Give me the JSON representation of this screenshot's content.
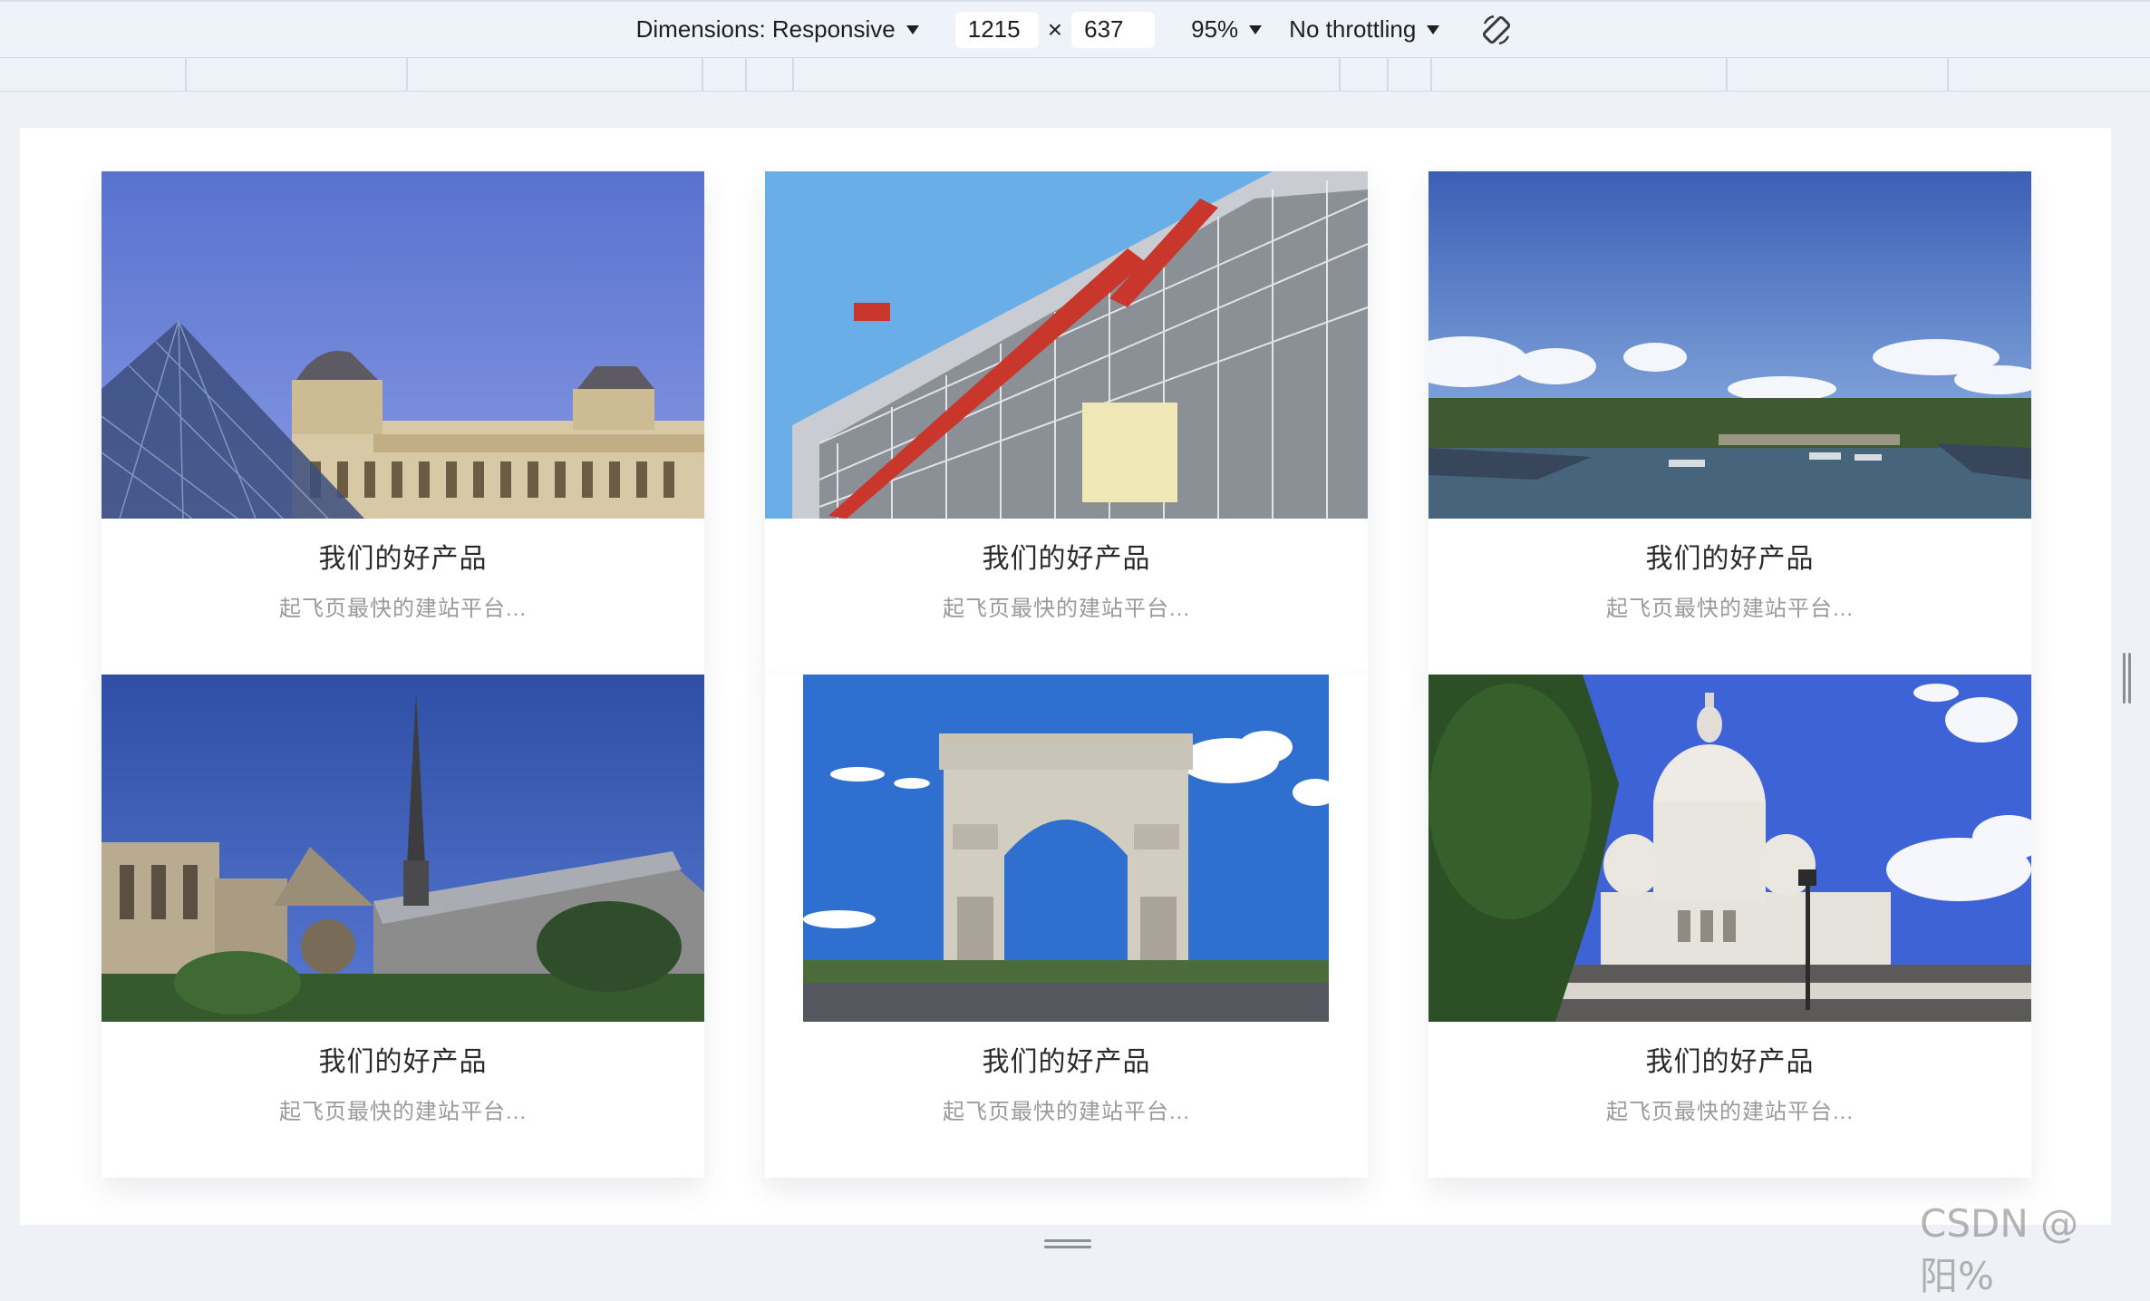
{
  "toolbar": {
    "dimensions_label": "Dimensions: Responsive",
    "width": "1215",
    "times": "×",
    "height": "637",
    "zoom": "95%",
    "throttling": "No throttling"
  },
  "cards": [
    {
      "title": "我们的好产品",
      "desc": "起飞页最快的建站平台..."
    },
    {
      "title": "我们的好产品",
      "desc": "起飞页最快的建站平台..."
    },
    {
      "title": "我们的好产品",
      "desc": "起飞页最快的建站平台..."
    },
    {
      "title": "我们的好产品",
      "desc": "起飞页最快的建站平台..."
    },
    {
      "title": "我们的好产品",
      "desc": "起飞页最快的建站平台..."
    },
    {
      "title": "我们的好产品",
      "desc": "起飞页最快的建站平台..."
    }
  ],
  "watermark": "CSDN @阳%",
  "icons": {
    "dimensions": "chevron-down-icon",
    "zoom": "chevron-down-icon",
    "throttling": "chevron-down-icon",
    "rotate": "rotate-icon"
  }
}
